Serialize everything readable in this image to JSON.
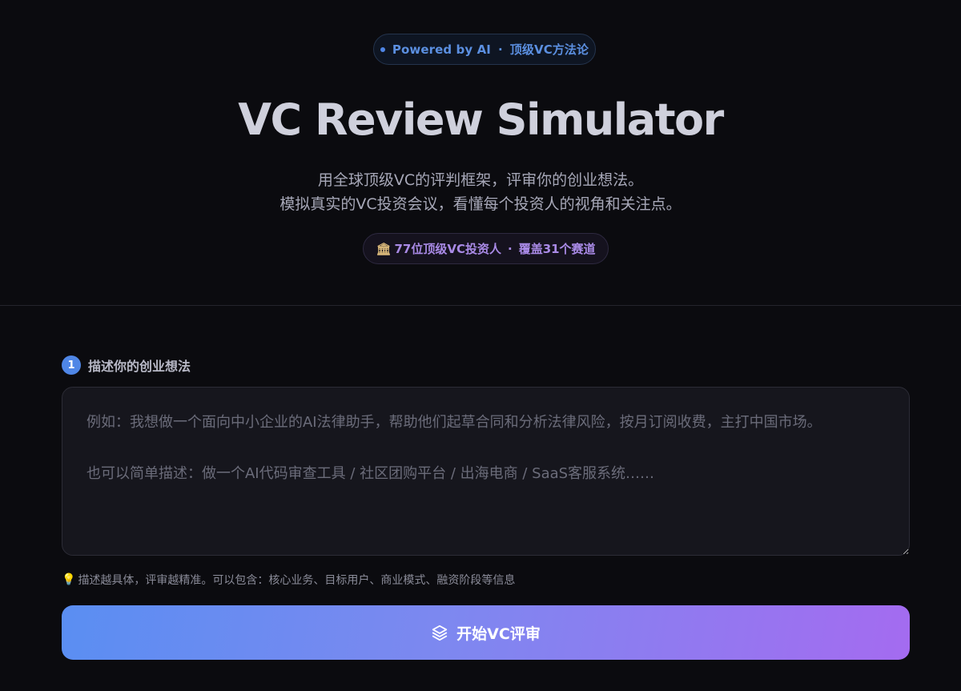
{
  "hero": {
    "powered_pill": {
      "left": "Powered by AI",
      "separator": "·",
      "right": "顶级VC方法论"
    },
    "title": "VC Review Simulator",
    "subtitle_line1": "用全球顶级VC的评判框架，评审你的创业想法。",
    "subtitle_line2": "模拟真实的VC投资会议，看懂每个投资人的视角和关注点。",
    "stats_pill": {
      "icon": "🏛",
      "left": "77位顶级VC投资人",
      "separator": "·",
      "right": "覆盖31个赛道"
    }
  },
  "form": {
    "step_number": "1",
    "step_label": "描述你的创业想法",
    "idea_value": "",
    "idea_placeholder": "例如：我想做一个面向中小企业的AI法律助手，帮助他们起草合同和分析法律风险，按月订阅收费，主打中国市场。\n\n也可以简单描述：做一个AI代码审查工具 / 社区团购平台 / 出海电商 / SaaS客服系统……",
    "hint_icon": "💡",
    "hint": "描述越具体，评审越精准。可以包含：核心业务、目标用户、商业模式、融资阶段等信息",
    "submit_label": "开始VC评审",
    "submit_icon": "layers-icon"
  },
  "colors": {
    "background": "#0b0b0f",
    "accent_blue": "#4f86e6",
    "accent_purple": "#a46bf0"
  }
}
